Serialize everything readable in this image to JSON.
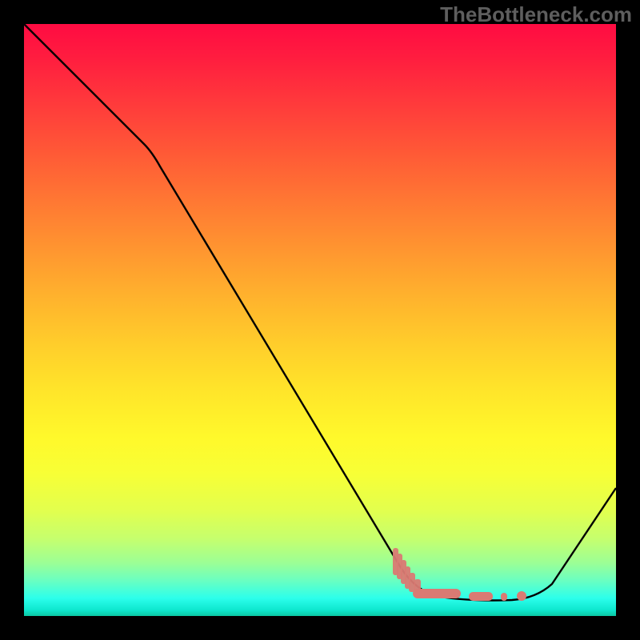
{
  "watermark": "TheBottleneck.com",
  "colors": {
    "frame": "#000000",
    "watermark": "#5e5e5e",
    "curve": "#000000",
    "marker": "#d97a73"
  },
  "chart_data": {
    "type": "line",
    "title": "",
    "xlabel": "",
    "ylabel": "",
    "xlim": [
      0,
      100
    ],
    "ylim": [
      0,
      100
    ],
    "grid": false,
    "legend": false,
    "annotations": [],
    "series": [
      {
        "name": "bottleneck-curve",
        "x": [
          0,
          20,
          64,
          70,
          76,
          82,
          88,
          100
        ],
        "values": [
          100,
          80,
          8.5,
          3.5,
          2.8,
          2.6,
          4.5,
          22
        ]
      }
    ],
    "markers": {
      "name": "optimal-zone",
      "style": "thick-dash",
      "x": [
        63,
        66,
        69.5,
        72,
        75.5,
        78.5,
        82
      ],
      "values": [
        10.2,
        6.8,
        4.2,
        3.4,
        3.0,
        2.9,
        2.8
      ]
    },
    "note": "Axes and ticks are not rendered in the image; values are estimated in percent of plot width/height."
  }
}
